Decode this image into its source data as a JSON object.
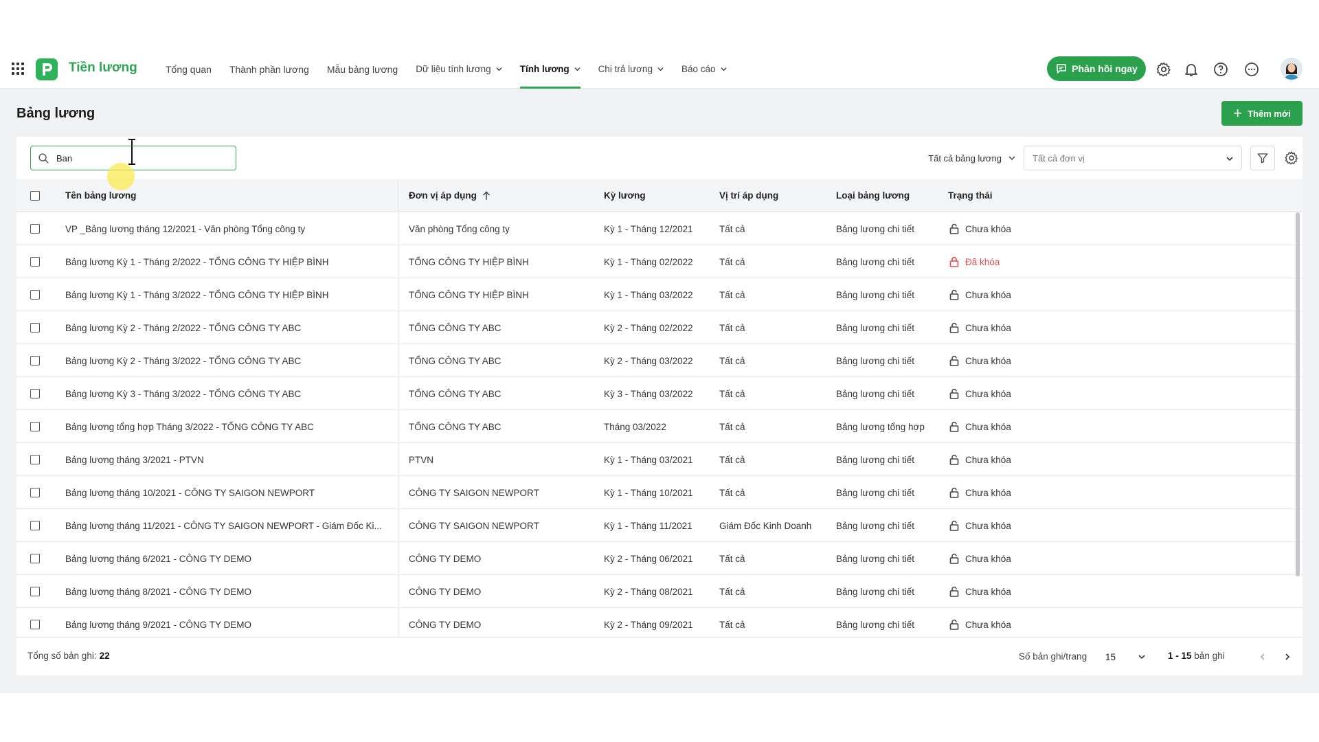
{
  "app": {
    "brand": "Tiền lương"
  },
  "nav": {
    "items": [
      {
        "label": "Tổng quan",
        "dropdown": false,
        "active": false
      },
      {
        "label": "Thành phần lương",
        "dropdown": false,
        "active": false
      },
      {
        "label": "Mẫu bảng lương",
        "dropdown": false,
        "active": false
      },
      {
        "label": "Dữ liệu tính lương",
        "dropdown": true,
        "active": false
      },
      {
        "label": "Tính lương",
        "dropdown": true,
        "active": true
      },
      {
        "label": "Chi trả lương",
        "dropdown": true,
        "active": false
      },
      {
        "label": "Báo cáo",
        "dropdown": true,
        "active": false
      }
    ],
    "feedback_label": "Phản hồi ngay"
  },
  "page": {
    "title": "Bảng lương",
    "add_label": "Thêm mới"
  },
  "search": {
    "value": "Ban",
    "placeholder": ""
  },
  "filters": {
    "type_filter": "Tất cả bảng lương",
    "unit_filter": "Tất cả đơn vị"
  },
  "table": {
    "columns": {
      "name": "Tên bảng lương",
      "unit": "Đơn vị áp dụng",
      "period": "Kỳ lương",
      "position": "Vị trí áp dụng",
      "type": "Loại bảng lương",
      "status": "Trạng thái"
    },
    "sort": {
      "column": "unit",
      "direction": "ascending"
    },
    "rows": [
      {
        "name": "VP _Bảng lương tháng 12/2021 - Văn phòng Tổng công ty",
        "unit": "Văn phòng Tổng công ty",
        "period": "Kỳ 1 - Tháng 12/2021",
        "position": "Tất cả",
        "type": "Bảng lương chi tiết",
        "status": "Chưa khóa",
        "locked": false
      },
      {
        "name": "Bảng lương Kỳ 1 - Tháng 2/2022 - TỔNG CÔNG TY HIỆP BÌNH",
        "unit": "TỔNG CÔNG TY HIỆP BÌNH",
        "period": "Kỳ 1 - Tháng 02/2022",
        "position": "Tất cả",
        "type": "Bảng lương chi tiết",
        "status": "Đã khóa",
        "locked": true
      },
      {
        "name": "Bảng lương Kỳ 1 - Tháng 3/2022 - TỔNG CÔNG TY HIỆP BÌNH",
        "unit": "TỔNG CÔNG TY HIỆP BÌNH",
        "period": "Kỳ 1 - Tháng 03/2022",
        "position": "Tất cả",
        "type": "Bảng lương chi tiết",
        "status": "Chưa khóa",
        "locked": false
      },
      {
        "name": "Bảng lương Kỳ 2 - Tháng 2/2022 - TỔNG CÔNG TY ABC",
        "unit": "TỔNG CÔNG TY ABC",
        "period": "Kỳ 2 - Tháng 02/2022",
        "position": "Tất cả",
        "type": "Bảng lương chi tiết",
        "status": "Chưa khóa",
        "locked": false
      },
      {
        "name": "Bảng lương Kỳ 2 - Tháng 3/2022 - TỔNG CÔNG TY ABC",
        "unit": "TỔNG CÔNG TY ABC",
        "period": "Kỳ 2 - Tháng 03/2022",
        "position": "Tất cả",
        "type": "Bảng lương chi tiết",
        "status": "Chưa khóa",
        "locked": false
      },
      {
        "name": "Bảng lương Kỳ 3 - Tháng 3/2022 - TỔNG CÔNG TY ABC",
        "unit": "TỔNG CÔNG TY ABC",
        "period": "Kỳ 3 - Tháng 03/2022",
        "position": "Tất cả",
        "type": "Bảng lương chi tiết",
        "status": "Chưa khóa",
        "locked": false
      },
      {
        "name": "Bảng lương tổng hợp Tháng 3/2022 - TỔNG CÔNG TY ABC",
        "unit": "TỔNG CÔNG TY ABC",
        "period": "Tháng 03/2022",
        "position": "Tất cả",
        "type": "Bảng lương tổng hợp",
        "status": "Chưa khóa",
        "locked": false
      },
      {
        "name": "Bảng lương tháng 3/2021 - PTVN",
        "unit": "PTVN",
        "period": "Kỳ 1 - Tháng 03/2021",
        "position": "Tất cả",
        "type": "Bảng lương chi tiết",
        "status": "Chưa khóa",
        "locked": false
      },
      {
        "name": "Bảng lương tháng 10/2021 - CÔNG TY SAIGON NEWPORT",
        "unit": "CÔNG TY SAIGON NEWPORT",
        "period": "Kỳ 1 - Tháng 10/2021",
        "position": "Tất cả",
        "type": "Bảng lương chi tiết",
        "status": "Chưa khóa",
        "locked": false
      },
      {
        "name": "Bảng lương tháng 11/2021 - CÔNG TY SAIGON NEWPORT - Giám Đốc Ki...",
        "unit": "CÔNG TY SAIGON NEWPORT",
        "period": "Kỳ 1 - Tháng 11/2021",
        "position": "Giám Đốc Kinh Doanh",
        "type": "Bảng lương chi tiết",
        "status": "Chưa khóa",
        "locked": false
      },
      {
        "name": "Bảng lương tháng 6/2021 - CÔNG TY DEMO",
        "unit": "CÔNG TY DEMO",
        "period": "Kỳ 2 - Tháng 06/2021",
        "position": "Tất cả",
        "type": "Bảng lương chi tiết",
        "status": "Chưa khóa",
        "locked": false
      },
      {
        "name": "Bảng lương tháng 8/2021 - CÔNG TY DEMO",
        "unit": "CÔNG TY DEMO",
        "period": "Kỳ 2 - Tháng 08/2021",
        "position": "Tất cả",
        "type": "Bảng lương chi tiết",
        "status": "Chưa khóa",
        "locked": false
      },
      {
        "name": "Bảng lương tháng 9/2021 - CÔNG TY DEMO",
        "unit": "CÔNG TY DEMO",
        "period": "Kỳ 2 - Tháng 09/2021",
        "position": "Tất cả",
        "type": "Bảng lương chi tiết",
        "status": "Chưa khóa",
        "locked": false
      }
    ]
  },
  "footer": {
    "total_label": "Tổng số bản ghi:",
    "total_value": "22",
    "per_page_label": "Số bản ghi/trang",
    "per_page_value": "15",
    "range_value": "1 - 15",
    "range_suffix": "bản ghi"
  },
  "colors": {
    "accent": "#2ca14d",
    "locked": "#e54848"
  },
  "icons": [
    "apps-grid-icon",
    "logo-icon",
    "chat-icon",
    "gear-icon",
    "bell-icon",
    "help-icon",
    "more-icon",
    "search-icon",
    "chevron-down-icon",
    "filter-icon",
    "sort-up-icon",
    "lock-icon",
    "chevron-left-icon",
    "chevron-right-icon",
    "plus-icon"
  ]
}
